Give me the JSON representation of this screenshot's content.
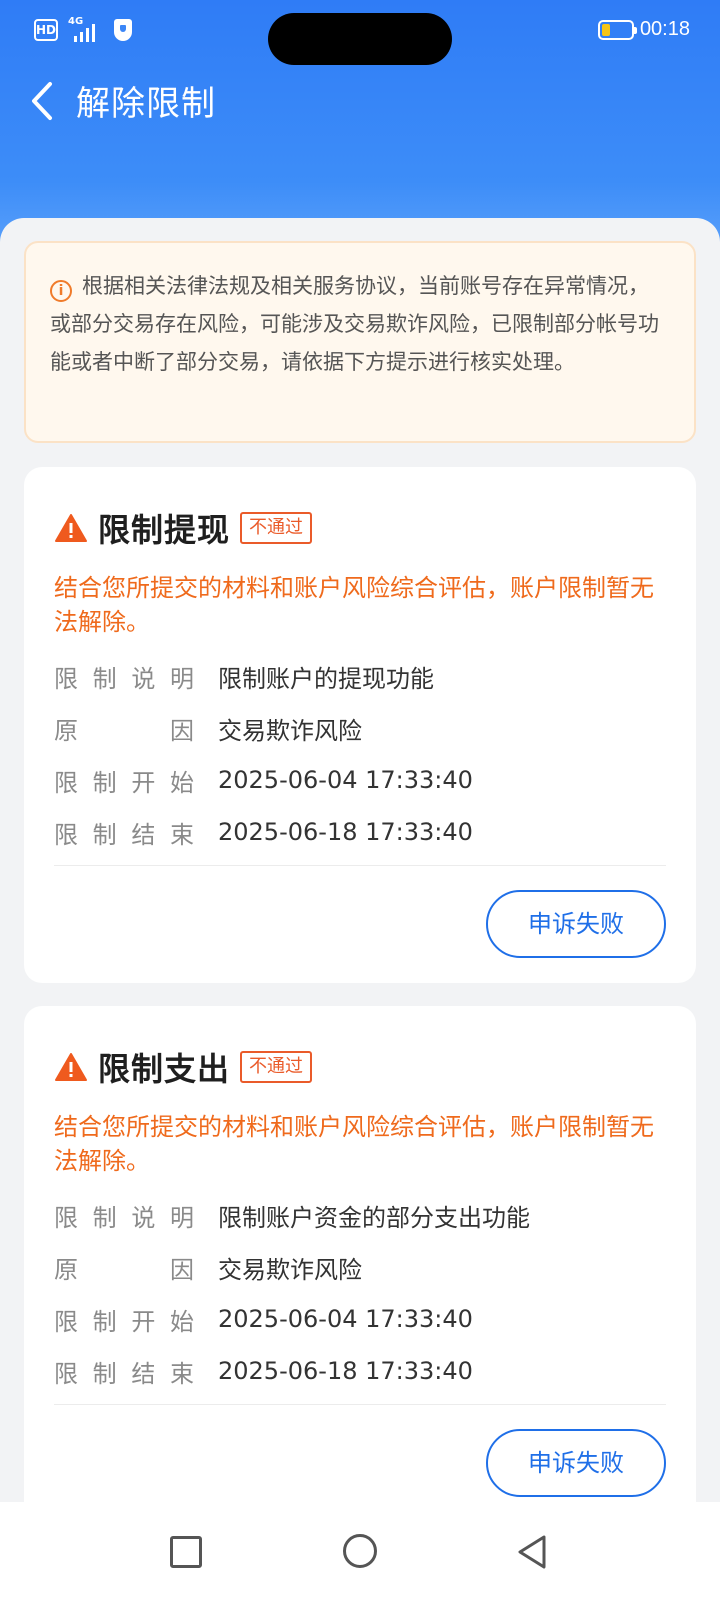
{
  "status_bar": {
    "hd_label": "HD",
    "network_label": "4G",
    "time": "00:18"
  },
  "header": {
    "title": "解除限制"
  },
  "notice": {
    "icon": "info-icon",
    "text": "根据相关法律法规及相关服务协议，当前账号存在异常情况，或部分交易存在风险，可能涉及交易欺诈风险，已限制部分帐号功能或者中断了部分交易，请依据下方提示进行核实处理。"
  },
  "cards": [
    {
      "title": "限制提现",
      "badge": "不通过",
      "message": "结合您所提交的材料和账户风险综合评估，账户限制暂无法解除。",
      "rows": [
        {
          "key": "限制说明",
          "value": "限制账户的提现功能"
        },
        {
          "key": "原因",
          "value": "交易欺诈风险"
        },
        {
          "key": "限制开始",
          "value": "2025-06-04 17:33:40"
        },
        {
          "key": "限制结束",
          "value": "2025-06-18 17:33:40"
        }
      ],
      "button_label": "申诉失败"
    },
    {
      "title": "限制支出",
      "badge": "不通过",
      "message": "结合您所提交的材料和账户风险综合评估，账户限制暂无法解除。",
      "rows": [
        {
          "key": "限制说明",
          "value": "限制账户资金的部分支出功能"
        },
        {
          "key": "原因",
          "value": "交易欺诈风险"
        },
        {
          "key": "限制开始",
          "value": "2025-06-04 17:33:40"
        },
        {
          "key": "限制结束",
          "value": "2025-06-18 17:33:40"
        }
      ],
      "button_label": "申诉失败"
    }
  ],
  "colors": {
    "header_blue": "#2f7cf6",
    "accent_orange": "#ef6a1c",
    "badge_red": "#ea5b2a",
    "button_blue": "#1f6fe8",
    "notice_bg": "#fff8ee"
  }
}
